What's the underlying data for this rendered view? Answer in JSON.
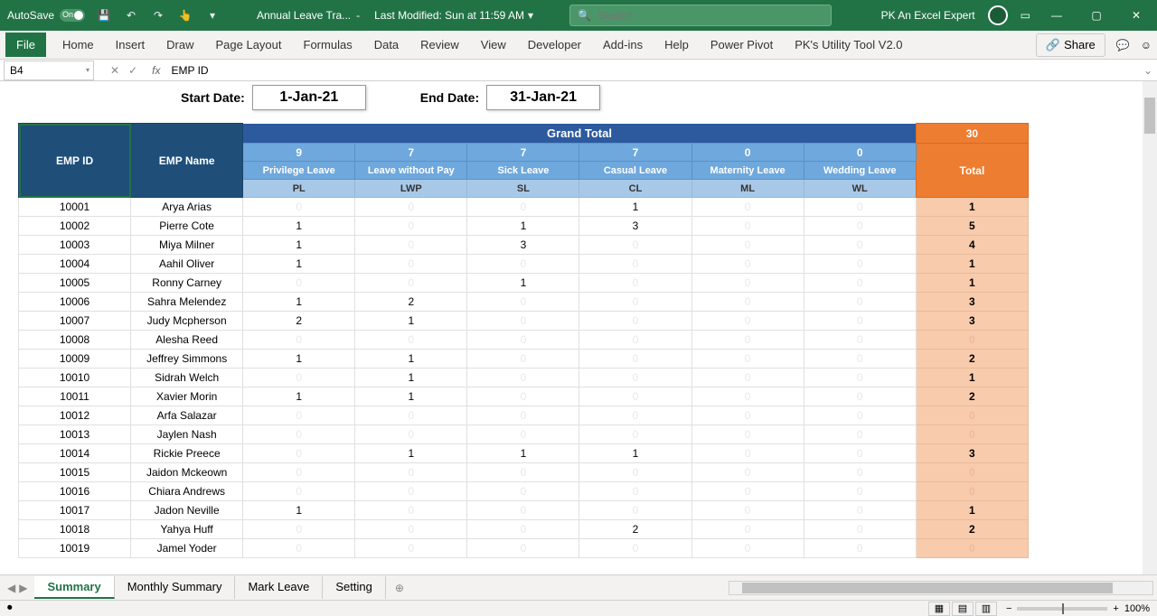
{
  "title_bar": {
    "autosave": "AutoSave",
    "autosave_on": "On",
    "doc_title": "Annual Leave Tra...",
    "separator": "-",
    "modified": "Last Modified: Sun at 11:59 AM",
    "search_placeholder": "Search",
    "user": "PK An Excel Expert"
  },
  "ribbon": {
    "tabs": [
      "File",
      "Home",
      "Insert",
      "Draw",
      "Page Layout",
      "Formulas",
      "Data",
      "Review",
      "View",
      "Developer",
      "Add-ins",
      "Help",
      "Power Pivot",
      "PK's Utility Tool V2.0"
    ],
    "share": "Share"
  },
  "formula_bar": {
    "name_box": "B4",
    "fx": "fx",
    "formula": "EMP ID"
  },
  "dates": {
    "start_label": "Start Date:",
    "start_value": "1-Jan-21",
    "end_label": "End Date:",
    "end_value": "31-Jan-21"
  },
  "table": {
    "grand_total": "Grand Total",
    "emp_id": "EMP ID",
    "emp_name": "EMP Name",
    "total": "Total",
    "counts": [
      "9",
      "7",
      "7",
      "7",
      "0",
      "0"
    ],
    "total_count": "30",
    "types": [
      "Privilege Leave",
      "Leave without Pay",
      "Sick Leave",
      "Casual Leave",
      "Maternity Leave",
      "Wedding Leave"
    ],
    "codes": [
      "PL",
      "LWP",
      "SL",
      "CL",
      "ML",
      "WL"
    ],
    "rows": [
      {
        "id": "10001",
        "name": "Arya Arias",
        "vals": [
          "0",
          "0",
          "0",
          "1",
          "0",
          "0"
        ],
        "total": "1"
      },
      {
        "id": "10002",
        "name": "Pierre Cote",
        "vals": [
          "1",
          "0",
          "1",
          "3",
          "0",
          "0"
        ],
        "total": "5"
      },
      {
        "id": "10003",
        "name": "Miya Milner",
        "vals": [
          "1",
          "0",
          "3",
          "0",
          "0",
          "0"
        ],
        "total": "4"
      },
      {
        "id": "10004",
        "name": "Aahil Oliver",
        "vals": [
          "1",
          "0",
          "0",
          "0",
          "0",
          "0"
        ],
        "total": "1"
      },
      {
        "id": "10005",
        "name": "Ronny Carney",
        "vals": [
          "0",
          "0",
          "1",
          "0",
          "0",
          "0"
        ],
        "total": "1"
      },
      {
        "id": "10006",
        "name": "Sahra Melendez",
        "vals": [
          "1",
          "2",
          "0",
          "0",
          "0",
          "0"
        ],
        "total": "3"
      },
      {
        "id": "10007",
        "name": "Judy Mcpherson",
        "vals": [
          "2",
          "1",
          "0",
          "0",
          "0",
          "0"
        ],
        "total": "3"
      },
      {
        "id": "10008",
        "name": "Alesha Reed",
        "vals": [
          "0",
          "0",
          "0",
          "0",
          "0",
          "0"
        ],
        "total": "0"
      },
      {
        "id": "10009",
        "name": "Jeffrey Simmons",
        "vals": [
          "1",
          "1",
          "0",
          "0",
          "0",
          "0"
        ],
        "total": "2"
      },
      {
        "id": "10010",
        "name": "Sidrah Welch",
        "vals": [
          "0",
          "1",
          "0",
          "0",
          "0",
          "0"
        ],
        "total": "1"
      },
      {
        "id": "10011",
        "name": "Xavier Morin",
        "vals": [
          "1",
          "1",
          "0",
          "0",
          "0",
          "0"
        ],
        "total": "2"
      },
      {
        "id": "10012",
        "name": "Arfa Salazar",
        "vals": [
          "0",
          "0",
          "0",
          "0",
          "0",
          "0"
        ],
        "total": "0"
      },
      {
        "id": "10013",
        "name": "Jaylen Nash",
        "vals": [
          "0",
          "0",
          "0",
          "0",
          "0",
          "0"
        ],
        "total": "0"
      },
      {
        "id": "10014",
        "name": "Rickie Preece",
        "vals": [
          "0",
          "1",
          "1",
          "1",
          "0",
          "0"
        ],
        "total": "3"
      },
      {
        "id": "10015",
        "name": "Jaidon Mckeown",
        "vals": [
          "0",
          "0",
          "0",
          "0",
          "0",
          "0"
        ],
        "total": "0"
      },
      {
        "id": "10016",
        "name": "Chiara Andrews",
        "vals": [
          "0",
          "0",
          "0",
          "0",
          "0",
          "0"
        ],
        "total": "0"
      },
      {
        "id": "10017",
        "name": "Jadon Neville",
        "vals": [
          "1",
          "0",
          "0",
          "0",
          "0",
          "0"
        ],
        "total": "1"
      },
      {
        "id": "10018",
        "name": "Yahya Huff",
        "vals": [
          "0",
          "0",
          "0",
          "2",
          "0",
          "0"
        ],
        "total": "2"
      },
      {
        "id": "10019",
        "name": "Jamel Yoder",
        "vals": [
          "0",
          "0",
          "0",
          "0",
          "0",
          "0"
        ],
        "total": "0"
      }
    ]
  },
  "sheet_tabs": [
    "Summary",
    "Monthly Summary",
    "Mark Leave",
    "Setting"
  ],
  "status": {
    "zoom": "100%"
  }
}
